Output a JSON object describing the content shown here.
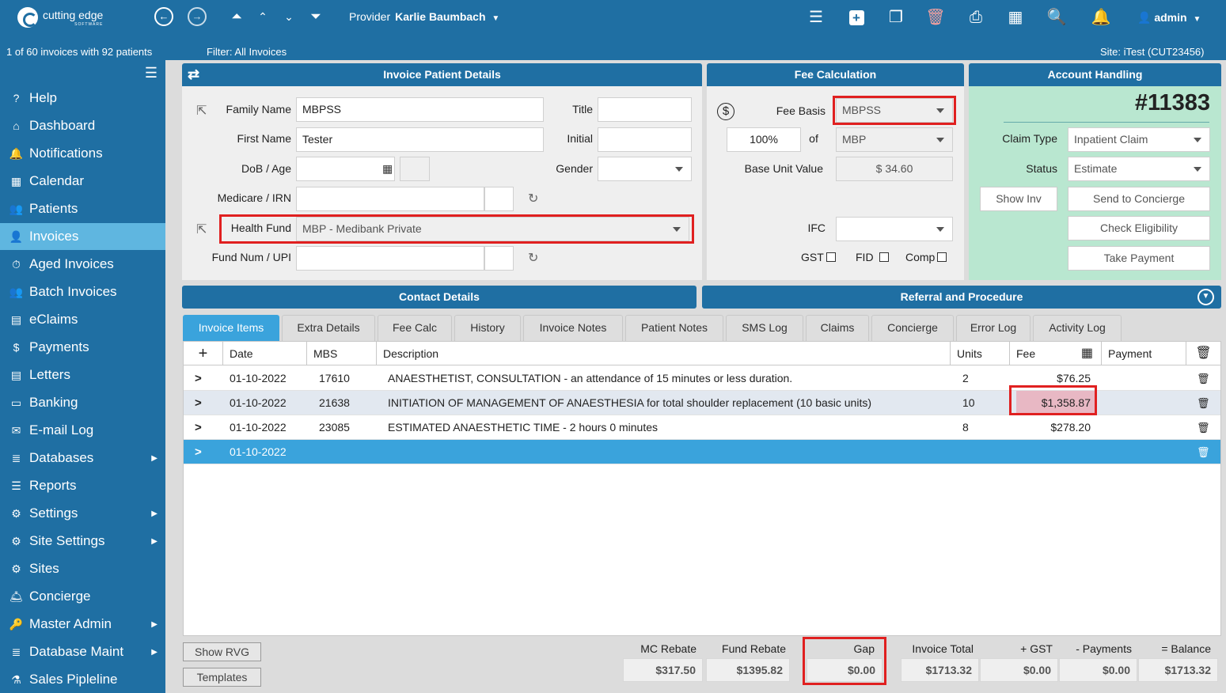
{
  "app": {
    "logo_text": "cutting edge",
    "logo_sub": "SOFTWARE"
  },
  "header": {
    "provider_label": "Provider",
    "provider_name": "Karlie Baumbach",
    "user": "admin"
  },
  "subbar": {
    "count": "1 of 60 invoices with 92 patients",
    "filter": "Filter: All Invoices",
    "site": "Site: iTest (CUT23456)"
  },
  "sidebar": {
    "items": [
      {
        "label": "Help",
        "icon": "?"
      },
      {
        "label": "Dashboard",
        "icon": "⌂"
      },
      {
        "label": "Notifications",
        "icon": "🔔"
      },
      {
        "label": "Calendar",
        "icon": "▦"
      },
      {
        "label": "Patients",
        "icon": "👥"
      },
      {
        "label": "Invoices",
        "icon": "👤"
      },
      {
        "label": "Aged Invoices",
        "icon": "⏱"
      },
      {
        "label": "Batch Invoices",
        "icon": "👥"
      },
      {
        "label": "eClaims",
        "icon": "▤"
      },
      {
        "label": "Payments",
        "icon": "$"
      },
      {
        "label": "Letters",
        "icon": "▤"
      },
      {
        "label": "Banking",
        "icon": "▭"
      },
      {
        "label": "E-mail Log",
        "icon": "✉"
      },
      {
        "label": "Databases",
        "icon": "≣"
      },
      {
        "label": "Reports",
        "icon": "☰"
      },
      {
        "label": "Settings",
        "icon": "⚙"
      },
      {
        "label": "Site Settings",
        "icon": "⚙"
      },
      {
        "label": "Sites",
        "icon": "⚙"
      },
      {
        "label": "Concierge",
        "icon": "🛎"
      },
      {
        "label": "Master Admin",
        "icon": "🔑"
      },
      {
        "label": "Database Maint",
        "icon": "≣"
      },
      {
        "label": "Sales Pipleline",
        "icon": "⚗"
      }
    ]
  },
  "patient": {
    "title": "Invoice Patient Details",
    "family_name_label": "Family Name",
    "family_name": "MBPSS",
    "first_name_label": "First Name",
    "first_name": "Tester",
    "dob_label": "DoB / Age",
    "dob": "",
    "age": "",
    "medicare_label": "Medicare / IRN",
    "medicare": "",
    "irn": "",
    "health_fund_label": "Health Fund",
    "health_fund": "MBP - Medibank Private",
    "fund_num_label": "Fund Num / UPI",
    "fund_num": "",
    "upi": "",
    "title_label": "Title",
    "title_val": "",
    "initial_label": "Initial",
    "initial": "",
    "gender_label": "Gender",
    "gender": ""
  },
  "fee": {
    "title": "Fee Calculation",
    "fee_basis_label": "Fee Basis",
    "fee_basis": "MBPSS",
    "percent": "100%",
    "of_label": "of",
    "of_value": "MBP",
    "base_unit_label": "Base Unit Value",
    "base_unit": "$ 34.60",
    "ifc_label": "IFC",
    "ifc": "",
    "gst_label": "GST",
    "fid_label": "FID",
    "comp_label": "Comp"
  },
  "account": {
    "title": "Account Handling",
    "invoice_number": "#11383",
    "claim_type_label": "Claim Type",
    "claim_type": "Inpatient Claim",
    "status_label": "Status",
    "status": "Estimate",
    "show_inv": "Show Inv",
    "send_concierge": "Send to Concierge",
    "check_eligibility": "Check Eligibility",
    "take_payment": "Take Payment"
  },
  "sections": {
    "contact": "Contact Details",
    "referral": "Referral and Procedure"
  },
  "tabs": [
    "Invoice Items",
    "Extra Details",
    "Fee Calc",
    "History",
    "Invoice Notes",
    "Patient Notes",
    "SMS Log",
    "Claims",
    "Concierge",
    "Error Log",
    "Activity Log"
  ],
  "grid": {
    "headers": {
      "add": "+",
      "date": "Date",
      "mbs": "MBS",
      "description": "Description",
      "units": "Units",
      "fee": "Fee",
      "payment": "Payment"
    },
    "rows": [
      {
        "date": "01-10-2022",
        "mbs": "17610",
        "description": "ANAESTHETIST, CONSULTATION - an attendance of 15 minutes or less duration.",
        "units": "2",
        "fee": "$76.25",
        "payment": ""
      },
      {
        "date": "01-10-2022",
        "mbs": "21638",
        "description": "INITIATION OF MANAGEMENT OF ANAESTHESIA for total shoulder replacement (10 basic units)",
        "units": "10",
        "fee": "$1,358.87",
        "payment": ""
      },
      {
        "date": "01-10-2022",
        "mbs": "23085",
        "description": "ESTIMATED ANAESTHETIC TIME - 2 hours 0 minutes",
        "units": "8",
        "fee": "$278.20",
        "payment": ""
      },
      {
        "date": "01-10-2022",
        "mbs": "",
        "description": "",
        "units": "",
        "fee": "",
        "payment": ""
      }
    ]
  },
  "bottom": {
    "show_rvg": "Show RVG",
    "templates": "Templates"
  },
  "totals": {
    "mc_rebate_label": "MC Rebate",
    "mc_rebate": "$317.50",
    "fund_rebate_label": "Fund Rebate",
    "fund_rebate": "$1395.82",
    "gap_label": "Gap",
    "gap": "$0.00",
    "invoice_total_label": "Invoice Total",
    "invoice_total": "$1713.32",
    "gst_label": "+ GST",
    "gst": "$0.00",
    "payments_label": "- Payments",
    "payments": "$0.00",
    "balance_label": "= Balance",
    "balance": "$1713.32"
  },
  "colors": {
    "primary": "#1f6fa3",
    "tab_active": "#3aa3dc",
    "account_bg": "#b9e7d0",
    "highlight": "#e02020"
  }
}
